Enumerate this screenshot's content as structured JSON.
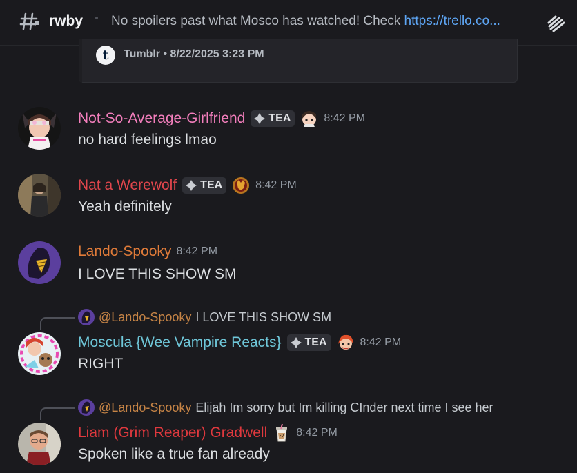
{
  "header": {
    "channel_name": "rwby",
    "topic_prefix": "No spoilers past what Mosco has watched! Check ",
    "topic_link": "https://trello.co..."
  },
  "embed": {
    "provider_icon": "t",
    "footer": "Tumblr • 8/22/2025 3:23 PM"
  },
  "colors": {
    "pink": "#f47fbd",
    "red": "#e0464c",
    "orange": "#e07b39",
    "teal": "#6fc7d9",
    "reaper_red": "#e0393e"
  },
  "messages": [
    {
      "author": "Not-So-Average-Girlfriend",
      "tag": "TEA",
      "time": "8:42 PM",
      "content": "no hard feelings lmao"
    },
    {
      "author": "Nat a Werewolf",
      "tag": "TEA",
      "time": "8:42 PM",
      "content": "Yeah definitely"
    },
    {
      "author": "Lando-Spooky",
      "time": "8:42 PM",
      "content": "I LOVE THIS SHOW SM"
    },
    {
      "reply_name": "@Lando-Spooky",
      "reply_text": "I LOVE THIS SHOW SM",
      "author": "Moscula {Wee Vampire Reacts}",
      "tag": "TEA",
      "time": "8:42 PM",
      "content": "RIGHT"
    },
    {
      "reply_name": "@Lando-Spooky",
      "reply_text": "Elijah Im sorry but Im killing CInder next time I see her",
      "author": "Liam (Grim Reaper) Gradwell",
      "time": "8:42 PM",
      "content": "Spoken like a true fan already"
    }
  ]
}
